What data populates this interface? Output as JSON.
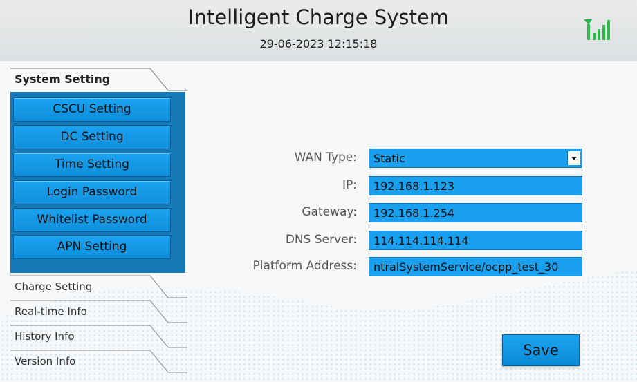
{
  "header": {
    "title": "Intelligent Charge System",
    "datetime": "29-06-2023 12:15:18",
    "signal_icon": "signal-strength-icon",
    "signal_color": "#2fb84a"
  },
  "sidebar": {
    "active_tab": "System Setting",
    "system_menu": [
      "CSCU Setting",
      "DC Setting",
      "Time Setting",
      "Login Password",
      "Whitelist Password",
      "APN Setting"
    ],
    "tabs": [
      "Charge Setting",
      "Real-time Info",
      "History Info",
      "Version Info"
    ]
  },
  "form": {
    "wan_type_label": "WAN Type:",
    "wan_type_value": "Static",
    "ip_label": "IP:",
    "ip_value": "192.168.1.123",
    "gateway_label": "Gateway:",
    "gateway_value": "192.168.1.254",
    "dns_label": "DNS Server:",
    "dns_value": "114.114.114.114",
    "platform_label": "Platform Address:",
    "platform_value": "ntralSystemService/ocpp_test_30"
  },
  "actions": {
    "save_label": "Save"
  },
  "colors": {
    "accent": "#19a0ee",
    "panel": "#1778b8"
  }
}
